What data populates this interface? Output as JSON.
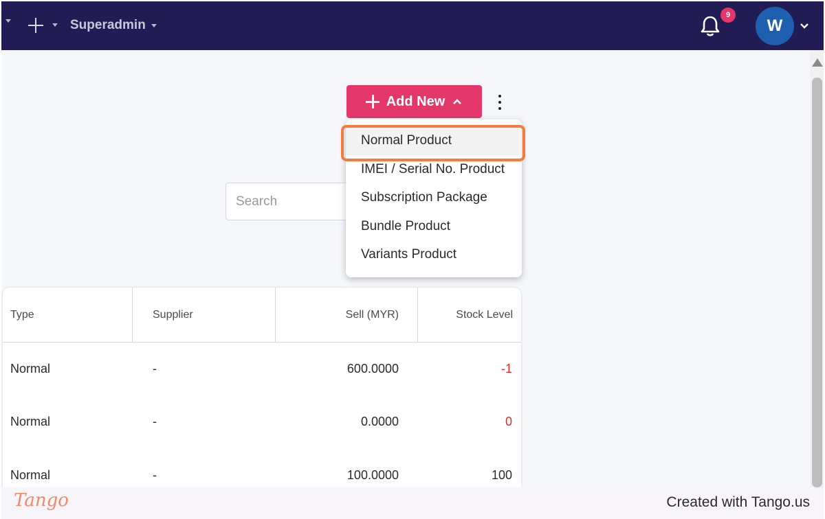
{
  "header": {
    "org_name": "Superadmin",
    "notification_count": "9",
    "avatar_initial": "W",
    "colors": {
      "bar": "#221c54",
      "badge": "#e6356b",
      "avatar": "#1f5fb0"
    }
  },
  "toolbar": {
    "add_new_label": "Add New",
    "accent": "#e5386a"
  },
  "search": {
    "placeholder": "Search"
  },
  "add_new_menu": {
    "items": [
      {
        "label": "Normal Product",
        "highlighted": true
      },
      {
        "label": "IMEI / Serial No. Product"
      },
      {
        "label": "Subscription Package"
      },
      {
        "label": "Bundle Product"
      },
      {
        "label": "Variants Product"
      }
    ]
  },
  "table": {
    "columns": [
      "Type",
      "Supplier",
      "Sell (MYR)",
      "Stock Level"
    ],
    "rows": [
      {
        "type": "Normal",
        "supplier": "-",
        "sell": "600.0000",
        "stock": "-1"
      },
      {
        "type": "Normal",
        "supplier": "-",
        "sell": "0.0000",
        "stock": "0"
      },
      {
        "type": "Normal",
        "supplier": "-",
        "sell": "100.0000",
        "stock": "100"
      }
    ]
  },
  "footer": {
    "logo": "Tango",
    "created_text": "Created with Tango.us"
  }
}
